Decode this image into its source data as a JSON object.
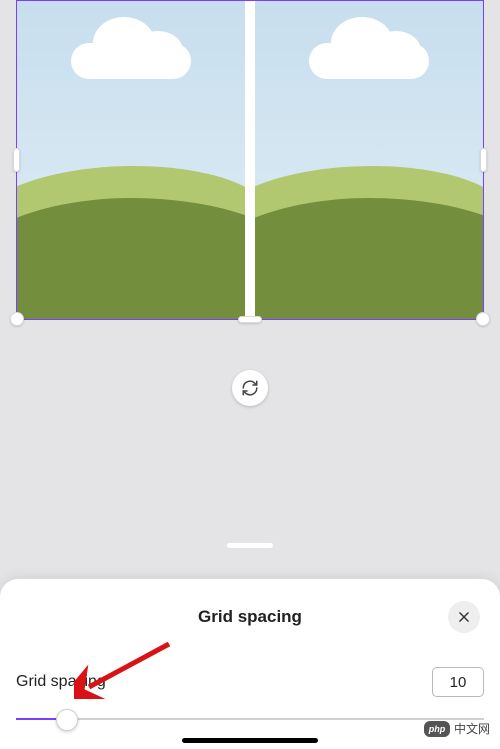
{
  "sheet": {
    "title": "Grid spacing",
    "label": "Grid spacing",
    "value": "10"
  },
  "slider": {
    "percent": 11
  },
  "watermark": {
    "logo": "php",
    "text": "中文网"
  }
}
